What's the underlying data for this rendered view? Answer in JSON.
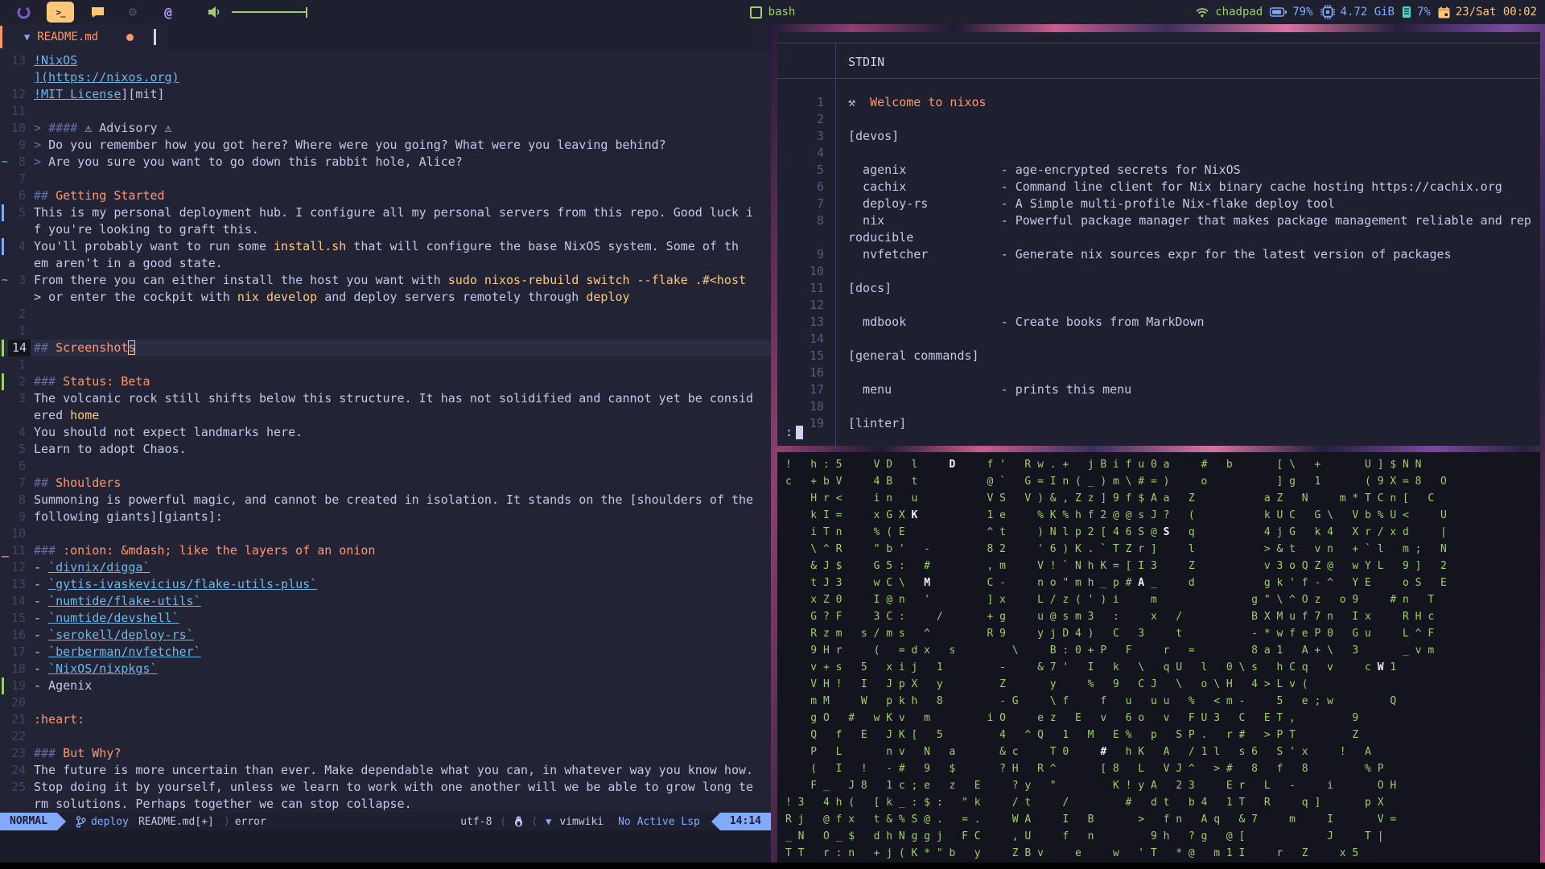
{
  "topbar": {
    "window_title": "bash",
    "workspaces": {
      "active_index": 1
    },
    "status": {
      "host": "chadpad",
      "battery": "79%",
      "memory": "4.72 GiB",
      "cpu": "7%",
      "datetime": "23/Sat 00:02"
    },
    "colors": {
      "accent_yellow": "#ffc777",
      "green": "#9ece6a",
      "blue": "#82aaff",
      "teal": "#4fd6be"
    }
  },
  "editor": {
    "tab": {
      "filename": "README.md"
    },
    "statusline": {
      "mode": "NORMAL",
      "branch": "deploy",
      "file": "README.md[+]",
      "diagnostic": "error",
      "encoding": "utf-8",
      "sep_l": "⟩",
      "sep_r": "⟨",
      "filetype": "vimwiki",
      "lsp": "No Active Lsp",
      "time": "14:14"
    },
    "rows": [
      {
        "g": "13",
        "seg": [
          {
            "t": "!NixOS",
            "c": "link"
          }
        ]
      },
      {
        "g": "",
        "seg": [
          {
            "t": "](https://nixos.org)",
            "c": "link"
          }
        ]
      },
      {
        "g": "12",
        "seg": [
          {
            "t": "!MIT License",
            "c": "link"
          },
          {
            "t": "][mit]",
            "c": "fg"
          }
        ]
      },
      {
        "g": "11",
        "seg": []
      },
      {
        "g": "10",
        "seg": [
          {
            "t": "> ",
            "c": "dim"
          },
          {
            "t": "#### ",
            "c": "dim"
          },
          {
            "t": "⚠ Advisory ⚠",
            "c": "fg"
          }
        ]
      },
      {
        "g": "9",
        "seg": [
          {
            "t": "> ",
            "c": "dim"
          },
          {
            "t": "Do you remember how you got here? Where were you going? What were you leaving behind?",
            "c": "fg"
          }
        ]
      },
      {
        "g": "8",
        "s": "t",
        "seg": [
          {
            "t": "> ",
            "c": "dim"
          },
          {
            "t": "Are you sure you want to go down this rabbit hole, Alice?",
            "c": "fg"
          }
        ]
      },
      {
        "g": "7",
        "seg": []
      },
      {
        "g": "6",
        "seg": [
          {
            "t": "## ",
            "c": "dim"
          },
          {
            "t": "Getting Started",
            "c": "head"
          }
        ]
      },
      {
        "g": "5",
        "s": "b",
        "seg": [
          {
            "t": "This is my personal deployment hub. I configure all my personal servers from this repo. Good luck i",
            "c": "fg"
          }
        ]
      },
      {
        "g": "",
        "seg": [
          {
            "t": "f you're looking to graft this.",
            "c": "fg"
          }
        ]
      },
      {
        "g": "4",
        "s": "b",
        "seg": [
          {
            "t": "You'll probably want to run some ",
            "c": "fg"
          },
          {
            "t": "install.sh",
            "c": "code"
          },
          {
            "t": " that will configure the base NixOS system. Some of th",
            "c": "fg"
          }
        ]
      },
      {
        "g": "",
        "seg": [
          {
            "t": "em aren't in a good state.",
            "c": "fg"
          }
        ]
      },
      {
        "g": "3",
        "s": "t",
        "seg": [
          {
            "t": "From there you can either install the host you want with ",
            "c": "fg"
          },
          {
            "t": "sudo nixos-rebuild switch --flake .#<host",
            "c": "code"
          }
        ]
      },
      {
        "g": "",
        "seg": [
          {
            "t": "> ",
            "c": "fg"
          },
          {
            "t": "or enter the cockpit with ",
            "c": "fg"
          },
          {
            "t": "nix develop",
            "c": "code"
          },
          {
            "t": " and deploy servers remotely through ",
            "c": "fg"
          },
          {
            "t": "deploy",
            "c": "code"
          }
        ]
      },
      {
        "g": "2",
        "seg": []
      },
      {
        "g": "1",
        "seg": []
      },
      {
        "g": "14",
        "cur": 1,
        "s": "g",
        "seg": [
          {
            "t": "## ",
            "c": "dim"
          },
          {
            "t": "Screenshot",
            "c": "head"
          },
          {
            "t": "s",
            "c": "cur"
          }
        ]
      },
      {
        "g": "1",
        "seg": []
      },
      {
        "g": "2",
        "s": "g",
        "seg": [
          {
            "t": "### ",
            "c": "dim"
          },
          {
            "t": "Status: Beta",
            "c": "head"
          }
        ]
      },
      {
        "g": "3",
        "seg": [
          {
            "t": "The volcanic rock still shifts below this structure. It has not solidified and cannot yet be consid",
            "c": "fg"
          }
        ]
      },
      {
        "g": "",
        "seg": [
          {
            "t": "ered ",
            "c": "fg"
          },
          {
            "t": "home",
            "c": "code"
          }
        ]
      },
      {
        "g": "4",
        "seg": [
          {
            "t": "You should not expect landmarks here.",
            "c": "fg"
          }
        ]
      },
      {
        "g": "5",
        "seg": [
          {
            "t": "Learn to adopt Chaos.",
            "c": "fg"
          }
        ]
      },
      {
        "g": "6",
        "seg": []
      },
      {
        "g": "7",
        "seg": [
          {
            "t": "## ",
            "c": "dim"
          },
          {
            "t": "Shoulders",
            "c": "head"
          }
        ]
      },
      {
        "g": "8",
        "seg": [
          {
            "t": "Summoning is powerful magic, and cannot be created in isolation. It stands on the [shoulders of the",
            "c": "fg"
          }
        ]
      },
      {
        "g": "9",
        "seg": [
          {
            "t": "following giants][giants]:",
            "c": "fg"
          }
        ]
      },
      {
        "g": "10",
        "seg": []
      },
      {
        "g": "11",
        "s": "r",
        "seg": [
          {
            "t": "### ",
            "c": "dim"
          },
          {
            "t": ":onion: &mdash; like the layers of an onion",
            "c": "head"
          }
        ]
      },
      {
        "g": "12",
        "seg": [
          {
            "t": "- ",
            "c": "fg"
          },
          {
            "t": "`divnix/digga`",
            "c": "link"
          }
        ]
      },
      {
        "g": "13",
        "seg": [
          {
            "t": "- ",
            "c": "fg"
          },
          {
            "t": "`gytis-ivaskevicius/flake-utils-plus`",
            "c": "link"
          }
        ]
      },
      {
        "g": "14",
        "seg": [
          {
            "t": "- ",
            "c": "fg"
          },
          {
            "t": "`numtide/flake-utils`",
            "c": "link"
          }
        ]
      },
      {
        "g": "15",
        "seg": [
          {
            "t": "- ",
            "c": "fg"
          },
          {
            "t": "`numtide/devshell`",
            "c": "link"
          }
        ]
      },
      {
        "g": "16",
        "seg": [
          {
            "t": "- ",
            "c": "fg"
          },
          {
            "t": "`serokell/deploy-rs`",
            "c": "link"
          }
        ]
      },
      {
        "g": "17",
        "seg": [
          {
            "t": "- ",
            "c": "fg"
          },
          {
            "t": "`berberman/nvfetcher`",
            "c": "link"
          }
        ]
      },
      {
        "g": "18",
        "seg": [
          {
            "t": "- ",
            "c": "fg"
          },
          {
            "t": "`NixOS/nixpkgs`",
            "c": "link"
          }
        ]
      },
      {
        "g": "19",
        "s": "g",
        "seg": [
          {
            "t": "- Agenix",
            "c": "fg"
          }
        ]
      },
      {
        "g": "20",
        "seg": []
      },
      {
        "g": "21",
        "seg": [
          {
            "t": ":heart:",
            "c": "head"
          }
        ]
      },
      {
        "g": "22",
        "seg": []
      },
      {
        "g": "23",
        "seg": [
          {
            "t": "### ",
            "c": "dim"
          },
          {
            "t": "But Why?",
            "c": "head"
          }
        ]
      },
      {
        "g": "24",
        "seg": [
          {
            "t": "The future is more uncertain than ever. Make dependable what you can, in whatever way you know how.",
            "c": "fg"
          }
        ]
      },
      {
        "g": "25",
        "seg": [
          {
            "t": "Stop doing it by yourself, unless we learn to work with one another will we be able to grow long te",
            "c": "fg"
          }
        ]
      },
      {
        "g": "",
        "seg": [
          {
            "t": "rm solutions. Perhaps together we can stop collapse.",
            "c": "fg"
          }
        ]
      }
    ]
  },
  "terminal_top": {
    "header": "STDIN",
    "prompt": ":",
    "rows": [
      {
        "g": "1",
        "seg": [
          {
            "t": "⚒  ",
            "c": "fg"
          },
          {
            "t": "Welcome to nixos",
            "c": "head"
          }
        ]
      },
      {
        "g": "2",
        "seg": []
      },
      {
        "g": "3",
        "seg": [
          {
            "t": "[devos]",
            "c": "fg"
          }
        ]
      },
      {
        "g": "4",
        "seg": []
      },
      {
        "g": "5",
        "seg": [
          {
            "t": "  agenix             - age-encrypted secrets for NixOS",
            "c": "fg"
          }
        ]
      },
      {
        "g": "6",
        "seg": [
          {
            "t": "  cachix             - Command line client for Nix binary cache hosting https://cachix.org",
            "c": "fg"
          }
        ]
      },
      {
        "g": "7",
        "seg": [
          {
            "t": "  deploy-rs          - A Simple multi-profile Nix-flake deploy tool",
            "c": "fg"
          }
        ]
      },
      {
        "g": "8",
        "seg": [
          {
            "t": "  nix                - Powerful package manager that makes package management reliable and rep",
            "c": "fg"
          }
        ]
      },
      {
        "g": "",
        "seg": [
          {
            "t": "roducible",
            "c": "fg"
          }
        ]
      },
      {
        "g": "9",
        "seg": [
          {
            "t": "  nvfetcher          - Generate nix sources expr for the latest version of packages",
            "c": "fg"
          }
        ]
      },
      {
        "g": "10",
        "seg": []
      },
      {
        "g": "11",
        "seg": [
          {
            "t": "[docs]",
            "c": "fg"
          }
        ]
      },
      {
        "g": "12",
        "seg": []
      },
      {
        "g": "13",
        "seg": [
          {
            "t": "  mdbook             - Create books from MarkDown",
            "c": "fg"
          }
        ]
      },
      {
        "g": "14",
        "seg": []
      },
      {
        "g": "15",
        "seg": [
          {
            "t": "[general commands]",
            "c": "fg"
          }
        ]
      },
      {
        "g": "16",
        "seg": []
      },
      {
        "g": "17",
        "seg": [
          {
            "t": "  menu               - prints this menu",
            "c": "fg"
          }
        ]
      },
      {
        "g": "18",
        "seg": []
      },
      {
        "g": "19",
        "seg": [
          {
            "t": "[linter]",
            "c": "fg"
          }
        ]
      }
    ]
  },
  "terminal_bottom": {
    "rows": [
      {
        "seg": [
          {
            "t": "!   h : 5     V D   l     ",
            "c": "g"
          },
          {
            "t": "D",
            "c": "w"
          },
          {
            "t": "     f '   R w . +   j B i f u 0 a     #   b       [ \\   +       U ] $ N N",
            "c": "g"
          }
        ]
      },
      {
        "seg": [
          {
            "t": "c   + b V     4 B   t           @ `   G = I n ( _ ) m \\ # = )     o           ] g   1       ( 9 X = 8   O",
            "c": "g"
          }
        ]
      },
      {
        "seg": [
          {
            "t": "    H r <     i n   u           V S   V ) & , Z z ] 9 f $ A a   Z           a Z   N     m * T C n [   C",
            "c": "g"
          }
        ]
      },
      {
        "seg": [
          {
            "t": "    k I =     x G X ",
            "c": "g"
          },
          {
            "t": "K",
            "c": "w"
          },
          {
            "t": "           1 e     % K % h f 2 @ @ s J ?   (           k U C   G \\   V b % U <     U",
            "c": "g"
          }
        ]
      },
      {
        "seg": [
          {
            "t": "    i T n     % ( E             ^ t     ) N l p 2 [ 4 6 S @ ",
            "c": "g"
          },
          {
            "t": "S",
            "c": "w"
          },
          {
            "t": "   q           4 j G   k 4   X r / x d     |",
            "c": "g"
          }
        ]
      },
      {
        "seg": [
          {
            "t": "    \\ ^ R     \" b '   -         8 2     ' 6 ) K . ` T Z r ]     l           > & t   v n   + ` l   m ;   N",
            "c": "g"
          }
        ]
      },
      {
        "seg": [
          {
            "t": "    & J $     G 5 :   #         , m     V ! ` N h K = [ I 3     Z           v 3 o Q Z @   w Y L   9 ]   2",
            "c": "g"
          }
        ]
      },
      {
        "seg": [
          {
            "t": "    t J 3     w C \\   ",
            "c": "g"
          },
          {
            "t": "M",
            "c": "w"
          },
          {
            "t": "         C -     n o \" m h _ p # ",
            "c": "g"
          },
          {
            "t": "A",
            "c": "w"
          },
          {
            "t": " _     d           g k ' f - ^   Y E     o S   E",
            "c": "g"
          }
        ]
      },
      {
        "seg": [
          {
            "t": "    x Z 0     I @ n   '         ] x     L / z ( ' ) i     m               g \" \\ ^ O z   o 9     # n   T",
            "c": "g"
          }
        ]
      },
      {
        "seg": [
          {
            "t": "    G ? F     3 C :     /       + g     u @ s m 3   :     x   /           B X M u f 7 n   I x     R H c",
            "c": "g"
          }
        ]
      },
      {
        "seg": [
          {
            "t": "    R z m   s / m s   ^         R 9     y j D 4 )   C   3     t           - * w f e P 0   G u     L ^ F",
            "c": "g"
          }
        ]
      },
      {
        "seg": [
          {
            "t": "    9 H r     (   = d x   s         \\     B : 0 + P   F     r   =         8 a 1   A + \\   3       _ v m",
            "c": "g"
          }
        ]
      },
      {
        "seg": [
          {
            "t": "    v + s   5   x i j   1         -     & 7 '   I   k   \\   q U   l   0 \\ s   h C q   v     c ",
            "c": "g"
          },
          {
            "t": "W",
            "c": "w"
          },
          {
            "t": " 1",
            "c": "g"
          }
        ]
      },
      {
        "seg": [
          {
            "t": "    V H !   I   J p X   y         Z       y     %   9   C J   \\   o \\ H   4 > L v (",
            "c": "g"
          }
        ]
      },
      {
        "seg": [
          {
            "t": "    m M     W   p k h   8         - G     \\ f     f   u   u u   %   < m -     5   e ; w         Q",
            "c": "g"
          }
        ]
      },
      {
        "seg": [
          {
            "t": "    g O   #   w K v   m         i O     e z   E   v   6 o   v   F U 3   C   E T ,         9",
            "c": "g"
          }
        ]
      },
      {
        "seg": [
          {
            "t": "    Q   f   E   J K [   5         4   ^ Q   1   M   E %   p   S P .   r #   > P T         Z",
            "c": "g"
          }
        ]
      },
      {
        "seg": [
          {
            "t": "    P   L       n v   N   a       & c     T 0     ",
            "c": "g"
          },
          {
            "t": "#",
            "c": "w"
          },
          {
            "t": "   h K   A   / 1 l   s 6   S ' x     !   A",
            "c": "g"
          }
        ]
      },
      {
        "seg": [
          {
            "t": "    (   I   !   - #   9   $       ? H   R ^       [ 8   L   V J ^   > #   8   f   8         % P",
            "c": "g"
          }
        ]
      },
      {
        "seg": [
          {
            "t": "    F _   J 8   1 c ; e   z   E     ? y   \"         K ! y A   2 3     E r   L   -     i       O H",
            "c": "g"
          }
        ]
      },
      {
        "seg": [
          {
            "t": "! 3   4 h (   [ k _ : $ :   \" k     / t     /         #   d t   b 4   1 T   R     q ]       p X",
            "c": "g"
          }
        ]
      },
      {
        "seg": [
          {
            "t": "R j   @ f x   t & % S @ .   = .     W A     I   B       >   f n   A q   & 7     m     I       V =",
            "c": "g"
          }
        ]
      },
      {
        "seg": [
          {
            "t": "_ N   O _ $   d h N g g j   F C     , U     f   n         9 h   ? g   @ [             J     T |",
            "c": "g"
          }
        ]
      },
      {
        "seg": [
          {
            "t": "T T   r : n   + j ( K * \" b   y     Z B v     e     w   ' T   * @   m 1 I     r   Z     x 5",
            "c": "g"
          }
        ]
      }
    ]
  }
}
